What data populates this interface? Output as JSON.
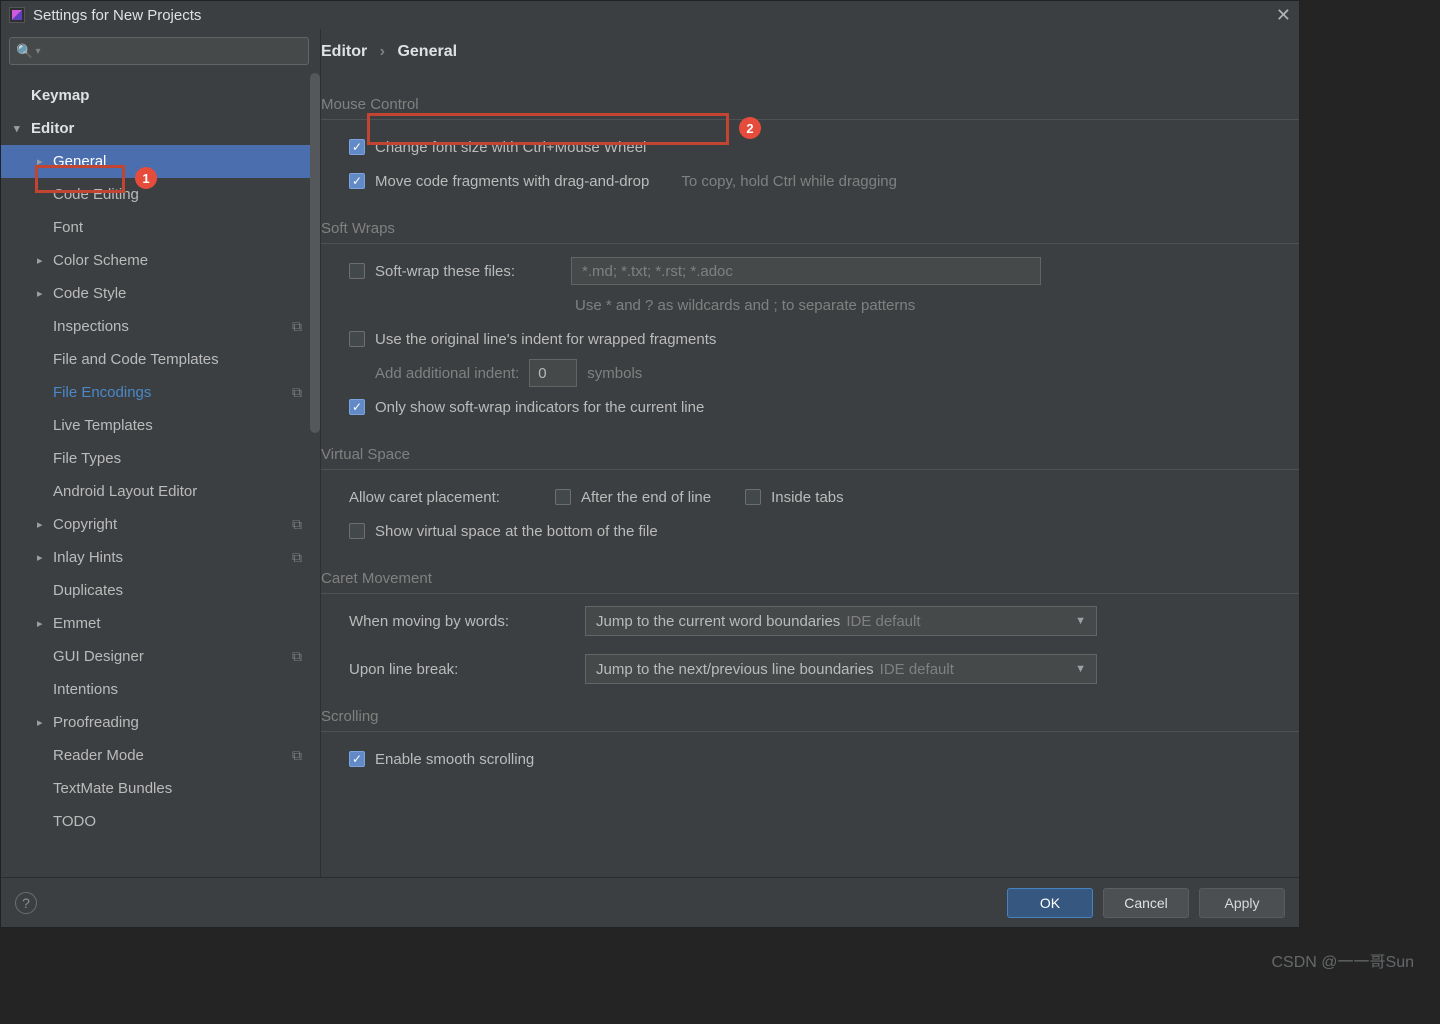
{
  "window": {
    "title": "Settings for New Projects"
  },
  "sidebar": {
    "search_placeholder": "",
    "items": {
      "keymap": "Keymap",
      "editor": "Editor",
      "general": "General",
      "code_editing": "Code Editing",
      "font": "Font",
      "color_scheme": "Color Scheme",
      "code_style": "Code Style",
      "inspections": "Inspections",
      "file_templates": "File and Code Templates",
      "file_encodings": "File Encodings",
      "live_templates": "Live Templates",
      "file_types": "File Types",
      "android_layout": "Android Layout Editor",
      "copyright": "Copyright",
      "inlay_hints": "Inlay Hints",
      "duplicates": "Duplicates",
      "emmet": "Emmet",
      "gui_designer": "GUI Designer",
      "intentions": "Intentions",
      "proofreading": "Proofreading",
      "reader_mode": "Reader Mode",
      "textmate": "TextMate Bundles",
      "todo": "TODO"
    }
  },
  "breadcrumb": {
    "a": "Editor",
    "b": "General"
  },
  "annotations": {
    "badge1": "1",
    "badge2": "2"
  },
  "mouse": {
    "title": "Mouse Control",
    "change_font": "Change font size with Ctrl+Mouse Wheel",
    "move_frag": "Move code fragments with drag-and-drop",
    "move_hint": "To copy, hold Ctrl while dragging"
  },
  "soft": {
    "title": "Soft Wraps",
    "wrap_files": "Soft-wrap these files:",
    "wrap_value": "*.md; *.txt; *.rst; *.adoc",
    "wildcards": "Use * and ? as wildcards and ; to separate patterns",
    "use_orig": "Use the original line's indent for wrapped fragments",
    "add_indent": "Add additional indent:",
    "add_indent_val": "0",
    "symbols": "symbols",
    "only_show": "Only show soft-wrap indicators for the current line"
  },
  "virtual": {
    "title": "Virtual Space",
    "allow": "Allow caret placement:",
    "after_eol": "After the end of line",
    "inside_tabs": "Inside tabs",
    "show_bottom": "Show virtual space at the bottom of the file"
  },
  "caret": {
    "title": "Caret Movement",
    "by_words": "When moving by words:",
    "by_words_val": "Jump to the current word boundaries",
    "line_break": "Upon line break:",
    "line_break_val": "Jump to the next/previous line boundaries",
    "ide_default": "IDE default"
  },
  "scroll": {
    "title": "Scrolling",
    "smooth": "Enable smooth scrolling"
  },
  "footer": {
    "ok": "OK",
    "cancel": "Cancel",
    "apply": "Apply"
  },
  "watermark": "CSDN @一一哥Sun"
}
